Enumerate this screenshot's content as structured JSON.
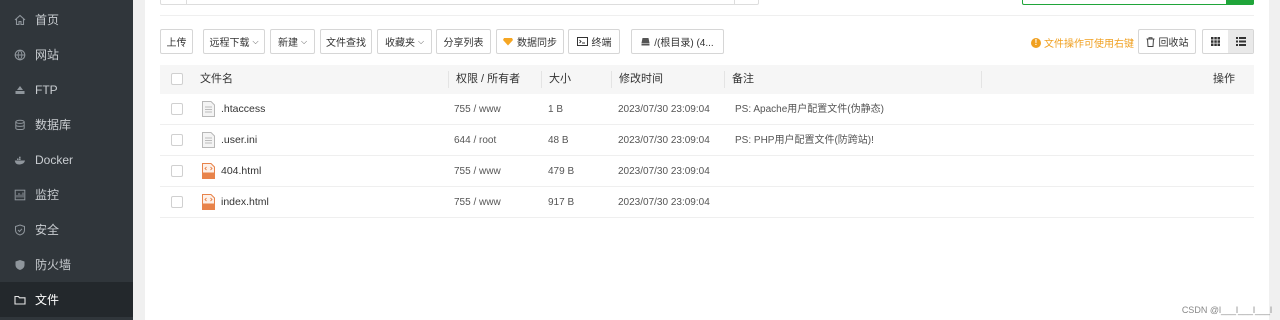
{
  "sidebar": {
    "items": [
      {
        "label": "首页",
        "icon": "home-icon"
      },
      {
        "label": "网站",
        "icon": "globe-icon"
      },
      {
        "label": "FTP",
        "icon": "ftp-icon"
      },
      {
        "label": "数据库",
        "icon": "database-icon"
      },
      {
        "label": "Docker",
        "icon": "docker-icon"
      },
      {
        "label": "监控",
        "icon": "monitor-icon"
      },
      {
        "label": "安全",
        "icon": "shield-icon"
      },
      {
        "label": "防火墙",
        "icon": "firewall-icon"
      },
      {
        "label": "文件",
        "icon": "folder-icon",
        "active": true
      }
    ]
  },
  "toolbar": {
    "upload": "上传",
    "remote_download": "远程下载",
    "new": "新建",
    "file_search": "文件查找",
    "favorites": "收藏夹",
    "share_list": "分享列表",
    "data_sync": "数据同步",
    "terminal": "终端",
    "disk": "/(根目录) (4...",
    "hint": "文件操作可使用右键",
    "recycle_bin": "回收站"
  },
  "table": {
    "headers": {
      "name": "文件名",
      "perm": "权限 / 所有者",
      "size": "大小",
      "mtime": "修改时间",
      "note": "备注",
      "action": "操作"
    },
    "rows": [
      {
        "name": ".htaccess",
        "perm": "755 / www",
        "size": "1 B",
        "mtime": "2023/07/30 23:09:04",
        "note": "PS: Apache用户配置文件(伪静态)",
        "type": "text"
      },
      {
        "name": ".user.ini",
        "perm": "644 / root",
        "size": "48 B",
        "mtime": "2023/07/30 23:09:04",
        "note": "PS: PHP用户配置文件(防跨站)!",
        "type": "text"
      },
      {
        "name": "404.html",
        "perm": "755 / www",
        "size": "479 B",
        "mtime": "2023/07/30 23:09:04",
        "note": "",
        "type": "html"
      },
      {
        "name": "index.html",
        "perm": "755 / www",
        "size": "917 B",
        "mtime": "2023/07/30 23:09:04",
        "note": "",
        "type": "html"
      }
    ]
  },
  "watermark": "CSDN @l___l___l___l",
  "colors": {
    "sidebar_bg": "#30363b",
    "sidebar_active": "#23282c",
    "accent_green": "#20a53a",
    "hint_orange": "#f0a020",
    "sync_icon": "#f5a623",
    "html_icon": "#e8834a"
  }
}
